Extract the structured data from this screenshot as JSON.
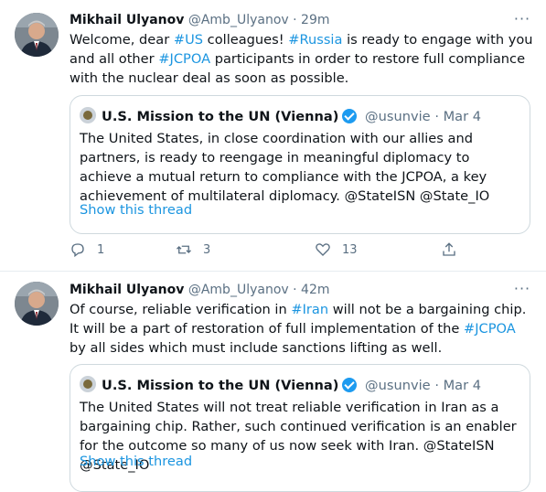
{
  "tweets": [
    {
      "name": "Mikhail Ulyanov",
      "handle": "@Amb_Ulyanov",
      "dot": "·",
      "time": "29m",
      "text_parts": [
        {
          "t": "Welcome, dear ",
          "tag": false
        },
        {
          "t": "#US",
          "tag": true
        },
        {
          "t": " colleagues! ",
          "tag": false
        },
        {
          "t": "#Russia",
          "tag": true
        },
        {
          "t": " is ready to engage with you and all other ",
          "tag": false
        },
        {
          "t": "#JCPOA",
          "tag": true
        },
        {
          "t": " participants in order to restore full compliance with the nuclear deal as soon as possible.",
          "tag": false
        }
      ],
      "quote": {
        "name": "U.S. Mission to the UN (Vienna)",
        "handle": "@usunvie",
        "dot": "·",
        "date": "Mar 4",
        "text": "The United States, in close coordination with our allies and partners, is ready to reengage in meaningful diplomacy to achieve a mutual return to compliance with the JCPOA, a key achievement of multilateral diplomacy. @StateISN @State_IO",
        "link": "Show this thread"
      },
      "actions": {
        "replies": "1",
        "retweets": "3",
        "likes": "13"
      }
    },
    {
      "name": "Mikhail Ulyanov",
      "handle": "@Amb_Ulyanov",
      "dot": "·",
      "time": "42m",
      "text_parts": [
        {
          "t": "Of course, reliable verification in ",
          "tag": false
        },
        {
          "t": "#Iran",
          "tag": true
        },
        {
          "t": " will not be a bargaining chip. It will be a part of restoration of full implementation of the ",
          "tag": false
        },
        {
          "t": "#JCPOA",
          "tag": true
        },
        {
          "t": " by all sides which must include sanctions lifting as well.",
          "tag": false
        }
      ],
      "quote": {
        "name": "U.S. Mission to the UN (Vienna)",
        "handle": "@usunvie",
        "dot": "·",
        "date": "Mar 4",
        "text": "The United States will not treat reliable verification in Iran as a bargaining chip. Rather, such continued verification is an enabler for the outcome so many of us now seek with Iran. @StateISN @State_IO",
        "link": "Show this thread"
      }
    }
  ],
  "more_glyph": "···",
  "colors": {
    "link": "#1b95e0",
    "muted": "#5b7083",
    "border": "#cfd9de"
  }
}
